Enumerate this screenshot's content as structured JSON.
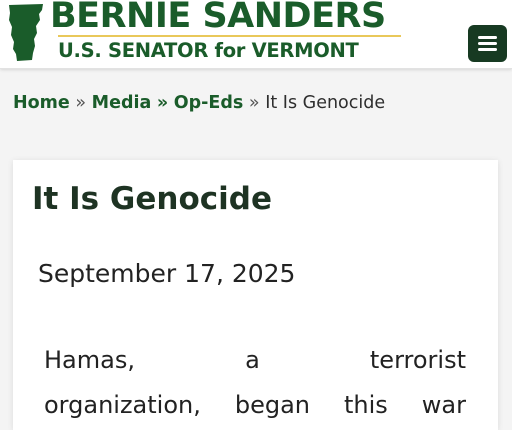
{
  "header": {
    "brand_name": "BERNIE SANDERS",
    "brand_subtitle": "U.S. SENATOR for VERMONT",
    "logo_icon": "vermont-map-icon",
    "menu_icon": "hamburger-menu-icon"
  },
  "breadcrumb": {
    "items": [
      "Home",
      "Media",
      "Op-Eds"
    ],
    "separator": "»",
    "current": "It Is Genocide"
  },
  "article": {
    "title": "It Is Genocide",
    "date": "September 17, 2025",
    "body_lines": [
      [
        "Hamas,",
        "a",
        "terrorist"
      ],
      [
        "organization,",
        "began",
        "this",
        "war"
      ]
    ]
  },
  "colors": {
    "brand_green": "#1a5c2a",
    "accent_gold": "#e9c85a",
    "menu_bg": "#173a22",
    "title_color": "#1e3323",
    "page_bg": "#f4f4f4"
  }
}
